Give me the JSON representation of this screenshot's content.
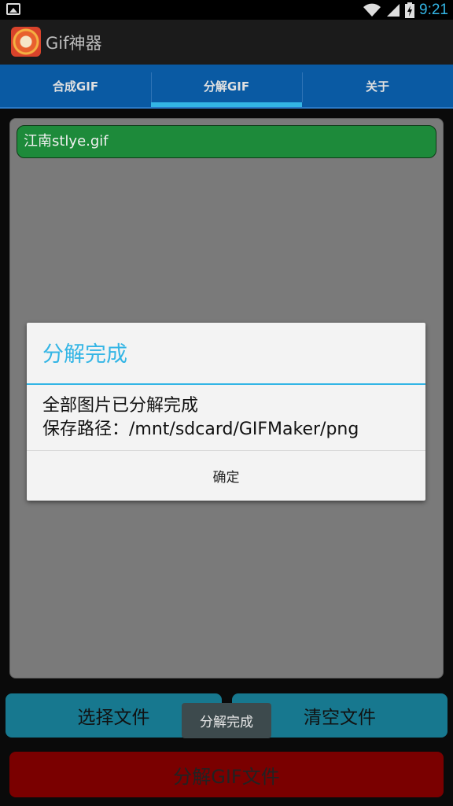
{
  "status_bar": {
    "time": "9:21"
  },
  "app": {
    "title": "Gif神器"
  },
  "tabs": [
    {
      "label": "合成GIF"
    },
    {
      "label": "分解GIF"
    },
    {
      "label": "关于"
    }
  ],
  "file_list": {
    "items": [
      "江南stlye.gif"
    ]
  },
  "buttons": {
    "select": "选择文件",
    "clear": "清空文件",
    "split": "分解GIF文件"
  },
  "toast": {
    "text": "分解完成"
  },
  "dialog": {
    "title": "分解完成",
    "message_line1": "全部图片已分解完成",
    "message_line2": "保存路径：/mnt/sdcard/GIFMaker/png",
    "ok": "确定"
  },
  "colors": {
    "accent": "#33b5e5",
    "tabbar": "#0a5aa3",
    "file_item": "#1d8a3a",
    "split_button": "#7a0000",
    "action_button": "#17788f"
  }
}
